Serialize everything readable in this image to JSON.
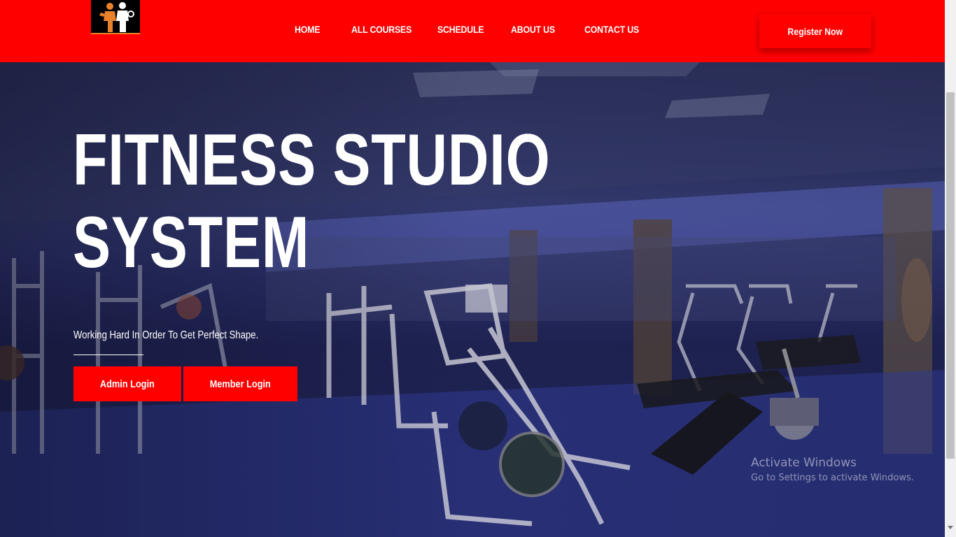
{
  "header": {
    "logo_icon": "fitness-couple-logo",
    "nav": [
      {
        "label": "HOME"
      },
      {
        "label": "ALL COURSES"
      },
      {
        "label": "SCHEDULE"
      },
      {
        "label": "ABOUT US"
      },
      {
        "label": "CONTACT US"
      }
    ],
    "register_label": "Register Now"
  },
  "hero": {
    "title_line1": "FITNESS STUDIO",
    "title_line2": "SYSTEM",
    "tagline": "Working Hard In Order To Get Perfect Shape.",
    "admin_login_label": "Admin Login",
    "member_login_label": "Member Login"
  },
  "watermark": {
    "line1": "Activate Windows",
    "line2": "Go to Settings to activate Windows."
  },
  "colors": {
    "accent": "#ff0000",
    "text": "#ffffff"
  }
}
